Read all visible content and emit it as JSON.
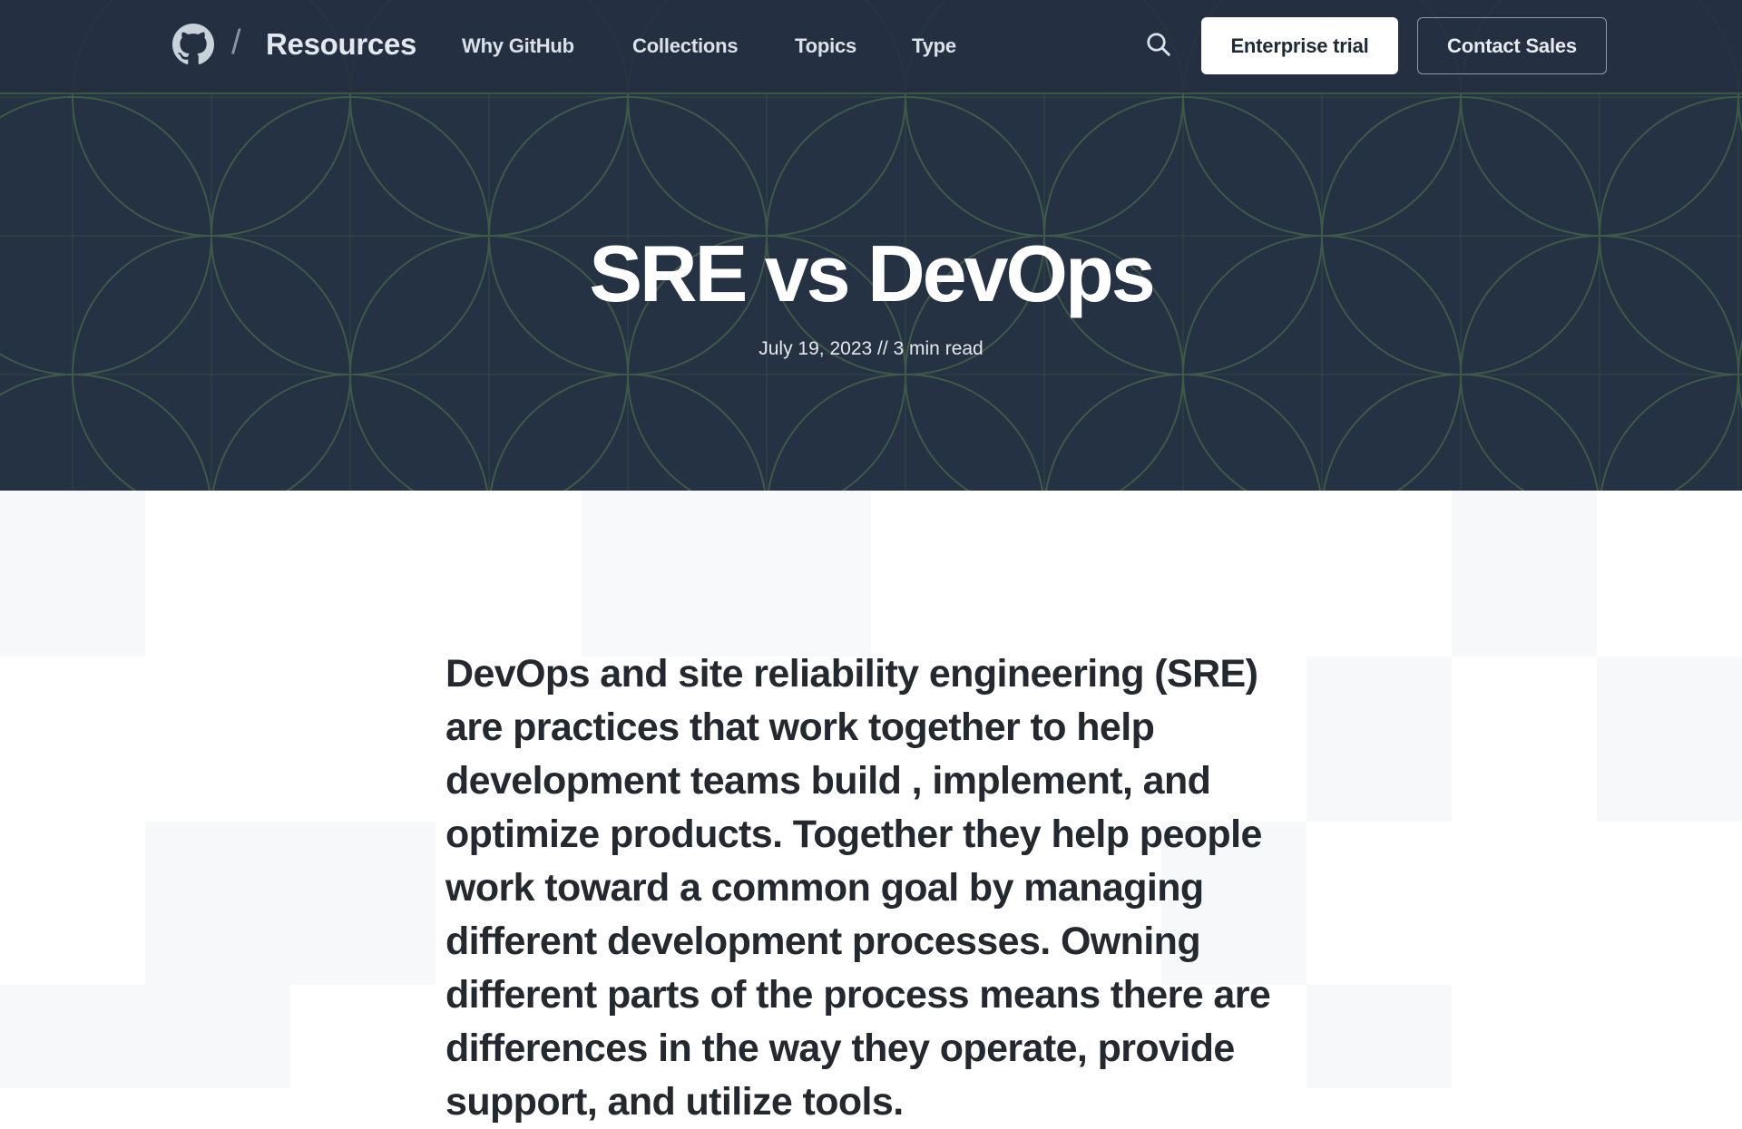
{
  "nav": {
    "brand": "Resources",
    "separator": "/",
    "links": [
      "Why GitHub",
      "Collections",
      "Topics",
      "Type"
    ],
    "search_icon": "search-icon",
    "logo_icon": "github-octocat-icon",
    "primary_button": "Enterprise trial",
    "secondary_button": "Contact Sales"
  },
  "hero": {
    "title": "SRE vs DevOps",
    "meta": "July 19, 2023 // 3 min read"
  },
  "article": {
    "lead": "DevOps and site reliability engineering (SRE) are practices that work together to help development teams build , implement, and optimize products. Together they help people work toward a common goal by managing different development processes. Owning different parts of the process means there are differences in the way they operate, provide support, and utilize tools."
  },
  "colors": {
    "hero_background": "#253243",
    "pattern_line": "#3f5a46",
    "primary_button_bg": "#ffffff",
    "body_text": "#24292f"
  }
}
